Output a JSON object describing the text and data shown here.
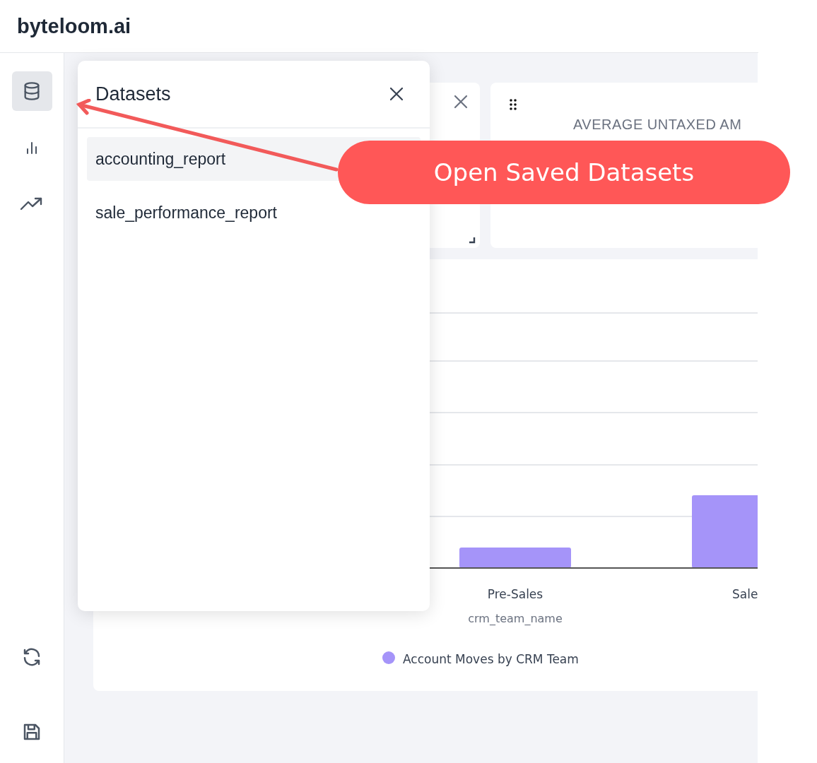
{
  "app": {
    "logo": "byteloom.ai"
  },
  "sidebar": {
    "items": [
      {
        "selected": true
      },
      {
        "selected": false
      },
      {
        "selected": false
      }
    ]
  },
  "widgets": [
    {
      "title": "AVERAGE UNTAXED AM"
    }
  ],
  "chart": {
    "categories": [
      "Pre-Sales",
      "Sale"
    ],
    "xlabel": "crm_team_name",
    "legend": "Account Moves by CRM Team"
  },
  "datasets_panel": {
    "title": "Datasets",
    "items": [
      {
        "label": "accounting_report",
        "selected": true
      },
      {
        "label": "sale_performance_report",
        "selected": false
      }
    ]
  },
  "callout": {
    "text": "Open Saved Datasets"
  }
}
